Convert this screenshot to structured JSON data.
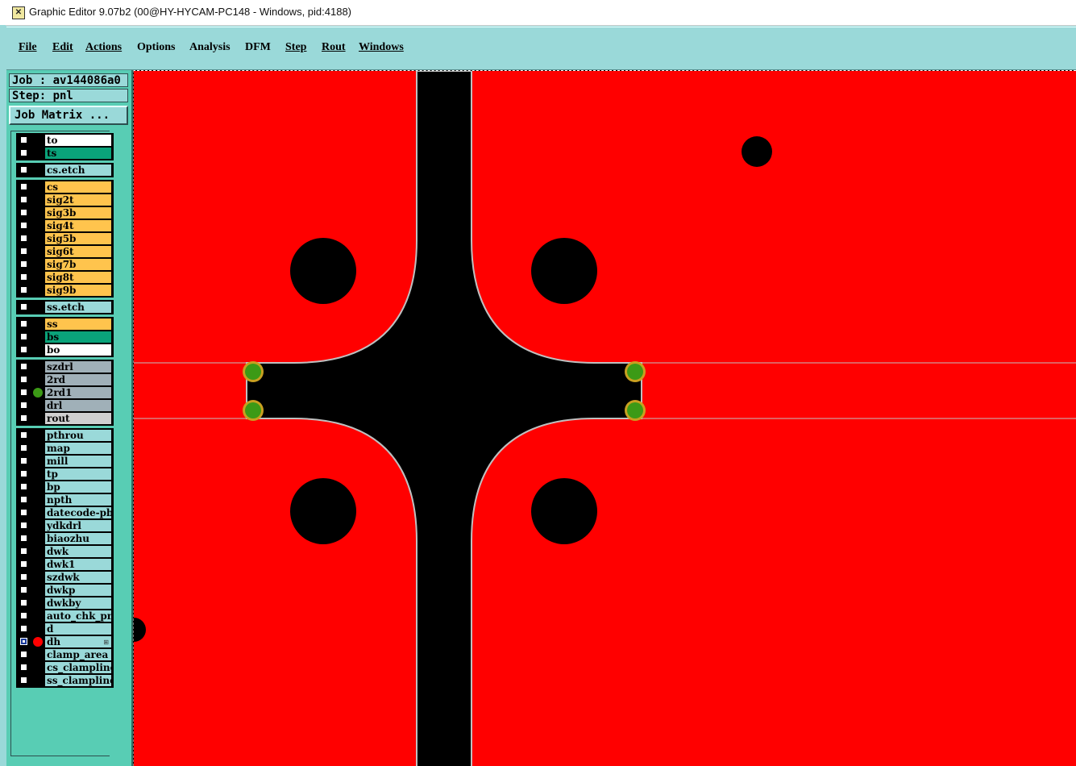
{
  "window": {
    "title": "Graphic Editor 9.07b2 (00@HY-HYCAM-PC148 - Windows, pid:4188)",
    "app_icon": "editor-app-icon"
  },
  "menu": [
    "File",
    "Edit",
    "Actions",
    "Options",
    "Analysis",
    "DFM",
    "Step",
    "Rout",
    "Windows"
  ],
  "job": {
    "job_label": "Job : av144086a0",
    "step_label": "Step: pnl",
    "matrix_button": "Job Matrix ..."
  },
  "colors": {
    "copper": "#ff0000",
    "clearance": "#000000",
    "pad_highlight": "#3c9a16",
    "pad_outline": "#c8a020",
    "layer_white": "#ffffff",
    "layer_green": "#0aa37a",
    "layer_etch": "#9ad9d9",
    "layer_signal": "#ffc44d",
    "layer_drill": "#a0b0b8",
    "layer_rout": "#d0d0d0",
    "layer_misc": "#9ad9d9"
  },
  "layer_groups": [
    {
      "layers": [
        {
          "name": "to",
          "color": "#ffffff"
        },
        {
          "name": "ts",
          "color": "#0aa37a"
        }
      ]
    },
    {
      "layers": [
        {
          "name": "cs.etch",
          "color": "#9ad9d9"
        }
      ]
    },
    {
      "layers": [
        {
          "name": "cs",
          "color": "#ffc44d"
        },
        {
          "name": "sig2t",
          "color": "#ffc44d"
        },
        {
          "name": "sig3b",
          "color": "#ffc44d"
        },
        {
          "name": "sig4t",
          "color": "#ffc44d"
        },
        {
          "name": "sig5b",
          "color": "#ffc44d"
        },
        {
          "name": "sig6t",
          "color": "#ffc44d"
        },
        {
          "name": "sig7b",
          "color": "#ffc44d"
        },
        {
          "name": "sig8t",
          "color": "#ffc44d"
        },
        {
          "name": "sig9b",
          "color": "#ffc44d"
        }
      ]
    },
    {
      "layers": [
        {
          "name": "ss.etch",
          "color": "#9ad9d9"
        }
      ]
    },
    {
      "layers": [
        {
          "name": "ss",
          "color": "#ffc44d"
        },
        {
          "name": "bs",
          "color": "#0aa37a"
        },
        {
          "name": "bo",
          "color": "#ffffff"
        }
      ]
    },
    {
      "layers": [
        {
          "name": "szdrl",
          "color": "#a0b0b8"
        },
        {
          "name": "2rd",
          "color": "#a0b0b8"
        },
        {
          "name": "2rd1",
          "color": "#a0b0b8",
          "indicator": "#3c9a16"
        },
        {
          "name": "drl",
          "color": "#a0b0b8"
        },
        {
          "name": "rout",
          "color": "#d0d0d0"
        }
      ]
    },
    {
      "layers": [
        {
          "name": "pthrou",
          "color": "#9ad9d9"
        },
        {
          "name": "map",
          "color": "#9ad9d9"
        },
        {
          "name": "mill",
          "color": "#9ad9d9"
        },
        {
          "name": "tp",
          "color": "#9ad9d9"
        },
        {
          "name": "bp",
          "color": "#9ad9d9"
        },
        {
          "name": "npth",
          "color": "#9ad9d9"
        },
        {
          "name": "datecode-pbe",
          "color": "#9ad9d9"
        },
        {
          "name": "ydkdrl",
          "color": "#9ad9d9"
        },
        {
          "name": "biaozhu",
          "color": "#9ad9d9"
        },
        {
          "name": "dwk",
          "color": "#9ad9d9"
        },
        {
          "name": "dwk1",
          "color": "#9ad9d9"
        },
        {
          "name": "szdwk",
          "color": "#9ad9d9"
        },
        {
          "name": "dwkp",
          "color": "#9ad9d9"
        },
        {
          "name": "dwkby",
          "color": "#9ad9d9"
        },
        {
          "name": "auto_chk_pnl",
          "color": "#9ad9d9"
        },
        {
          "name": "d",
          "color": "#9ad9d9"
        },
        {
          "name": "dh",
          "color": "#9ad9d9",
          "indicator": "#ff0000",
          "selected": true,
          "mark": "⊞"
        },
        {
          "name": "clamp_area",
          "color": "#9ad9d9"
        },
        {
          "name": "cs_clampline",
          "color": "#9ad9d9"
        },
        {
          "name": "ss_clampline",
          "color": "#9ad9d9"
        }
      ]
    }
  ]
}
